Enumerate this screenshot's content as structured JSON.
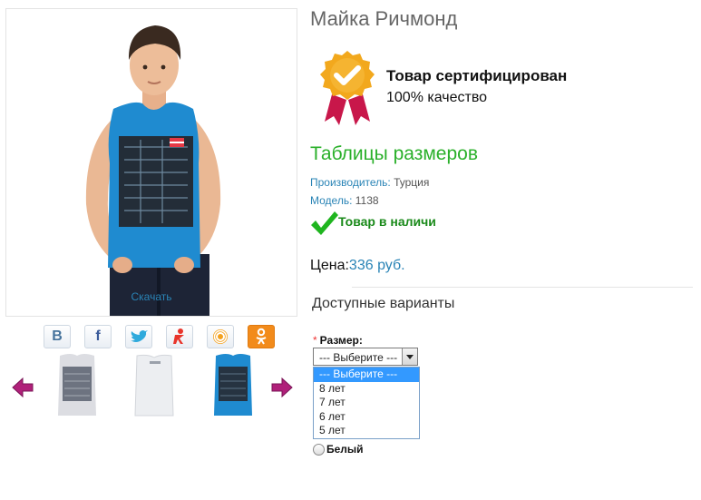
{
  "product": {
    "title": "Майка Ричмонд",
    "download_label": "Скачать"
  },
  "certificate": {
    "title": "Товар сертифицирован",
    "subtitle": "100% качество"
  },
  "size_table_link": "Таблицы размеров",
  "specs": {
    "manufacturer_label": "Производитель:",
    "manufacturer_value": "Турция",
    "model_label": "Модель:",
    "model_value": "1138"
  },
  "stock_status": "Товар в наличи",
  "price": {
    "label": "Цена:",
    "value": "336 руб."
  },
  "variants": {
    "title": "Доступные варианты",
    "size_required_mark": "*",
    "size_label": "Размер:",
    "select_value": "--- Выберите ---",
    "options": [
      "--- Выберите ---",
      "8 лет",
      "7 лет",
      "6 лет",
      "5 лет"
    ],
    "color_option": "Белый"
  },
  "social_icons": [
    "vkontakte-icon",
    "facebook-icon",
    "twitter-icon",
    "odnoklassniki-alt-icon",
    "mailru-icon",
    "odnoklassniki-icon"
  ],
  "colors": {
    "link_blue": "#2a84b6",
    "size_link_green": "#2ab02a",
    "stock_green": "#1a8a1a",
    "shirt_blue": "#1f8bd0",
    "arrow_magenta": "#b0207a",
    "badge_gold": "#f2a81d",
    "badge_ribbon": "#c8174a"
  }
}
